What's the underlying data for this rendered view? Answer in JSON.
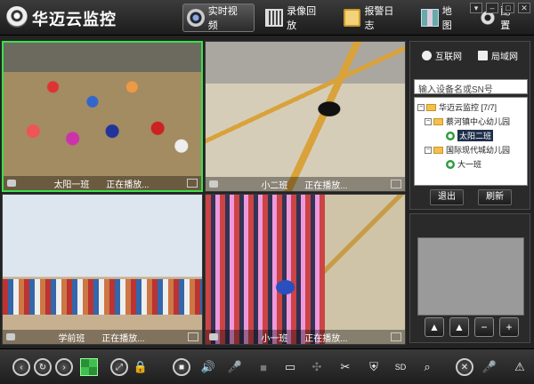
{
  "app": {
    "title": "华迈云监控"
  },
  "nav": {
    "live": "实时视频",
    "playback": "录像回放",
    "alarm_log": "报警日志",
    "map": "地图",
    "settings": "配置"
  },
  "panes": [
    {
      "name": "太阳一班",
      "status": "正在播放...",
      "selected": true
    },
    {
      "name": "小二班",
      "status": "正在播放...",
      "selected": false
    },
    {
      "name": "学前班",
      "status": "正在播放...",
      "selected": false
    },
    {
      "name": "小一班",
      "status": "正在播放...",
      "selected": false
    }
  ],
  "device_panel": {
    "tabs": [
      "互联网",
      "局域网"
    ],
    "search_placeholder": "输入设备名或SN号",
    "tree": {
      "root": "华迈云监控 [7/7]",
      "groups": [
        {
          "name": "蔡河镇中心幼儿园",
          "devices": [
            "太阳二班"
          ]
        },
        {
          "name": "国际现代城幼儿园",
          "devices": [
            "大一班"
          ]
        }
      ]
    },
    "logout": "退出",
    "refresh": "刷新"
  },
  "toolbar": {
    "sd_label": "SD"
  },
  "colors": {
    "selected_border": "#39e04a",
    "background": "#232323"
  }
}
